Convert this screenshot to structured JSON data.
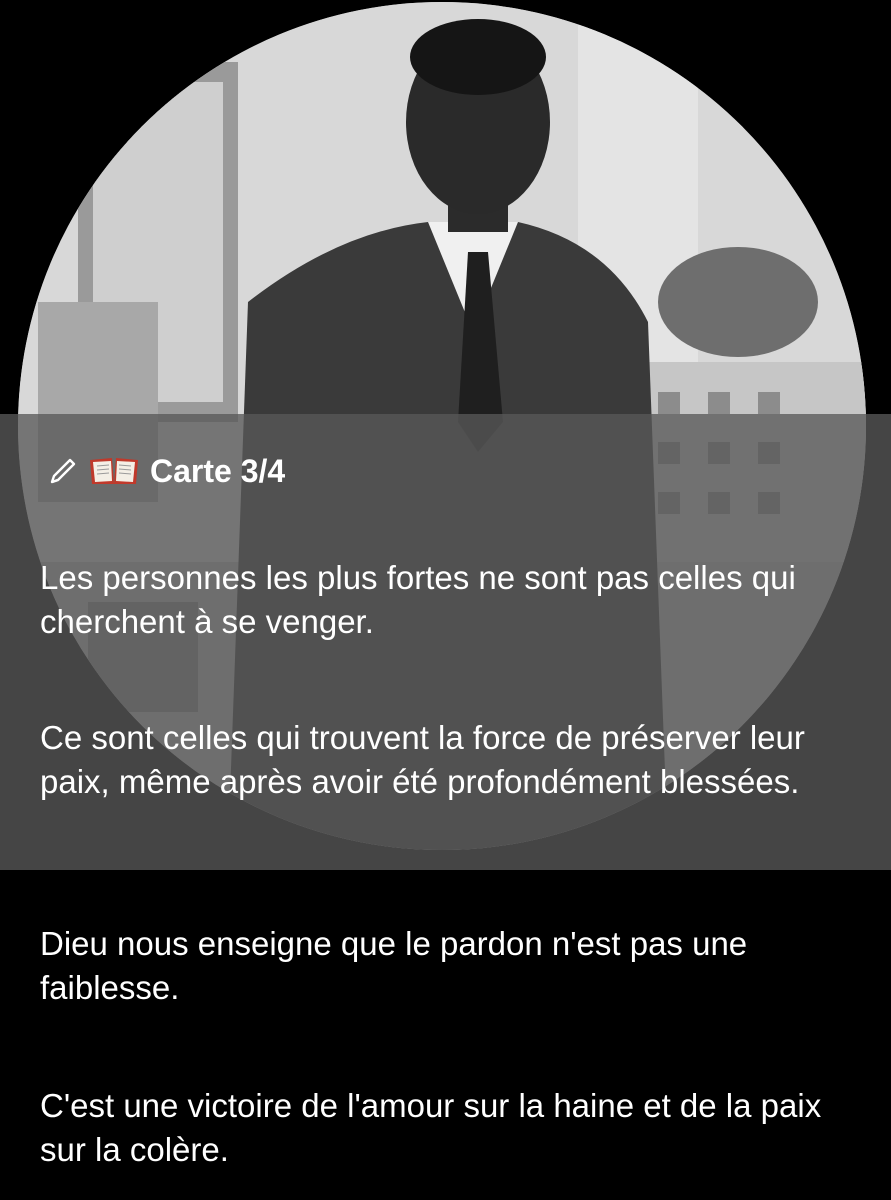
{
  "card": {
    "pencil_icon": "pencil-icon",
    "book_icon": "open-book-icon",
    "title": "Carte 3/4"
  },
  "paragraphs": {
    "p1": "Les personnes les plus fortes ne sont pas celles qui cherchent à se venger.",
    "p2": "Ce sont celles qui trouvent la force de préserver leur paix, même après avoir été profondément blessées.",
    "p3": "Dieu nous enseigne que le pardon n'est pas une faiblesse.",
    "p4": "C'est une victoire de l'amour sur la haine et de la paix sur la colère."
  },
  "colors": {
    "background": "#000000",
    "overlay": "#585858",
    "text": "#ffffff"
  }
}
